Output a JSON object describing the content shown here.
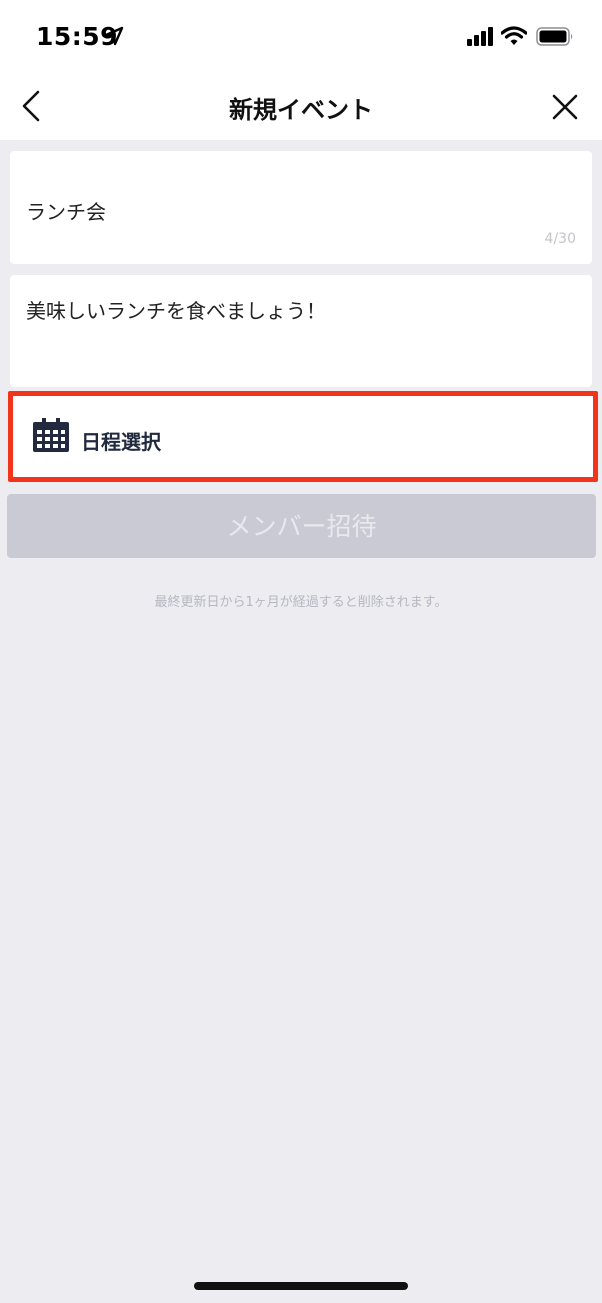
{
  "status_bar": {
    "time": "15:59",
    "icons": [
      "location-arrow-icon",
      "cellular-signal-icon",
      "wifi-icon",
      "battery-icon"
    ]
  },
  "header": {
    "title": "新規イベント",
    "back_icon": "chevron-left-icon",
    "close_icon": "close-icon"
  },
  "form": {
    "title_value": "ランチ会",
    "title_counter": "4/30",
    "description_value": "美味しいランチを食べましょう！",
    "schedule_label": "日程選択",
    "schedule_icon": "calendar-icon",
    "invite_button_label": "メンバー招待",
    "note": "最終更新日から1ヶ月が経過すると削除されます。"
  },
  "colors": {
    "highlight_border": "#f2341b",
    "disabled_button": "#c9cad3",
    "background": "#ececf1"
  }
}
